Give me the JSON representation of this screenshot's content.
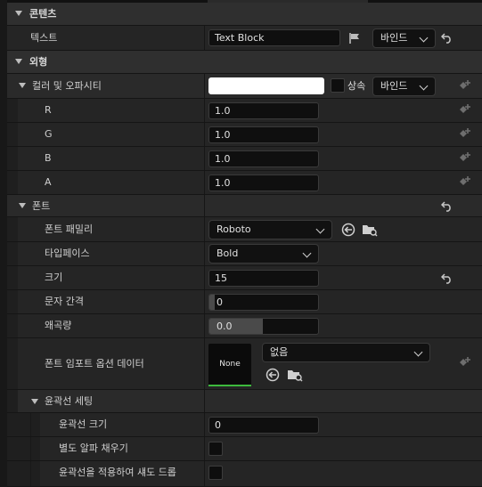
{
  "sections": {
    "content": {
      "title": "콘텐츠",
      "text_label": "텍스트",
      "text_value": "Text Block",
      "bind_label": "바인드"
    },
    "appearance": {
      "title": "외형",
      "color_label": "컬러 및 오파시티",
      "inherit_label": "상속",
      "bind_label": "바인드",
      "channels": [
        {
          "label": "R",
          "value": "1.0"
        },
        {
          "label": "G",
          "value": "1.0"
        },
        {
          "label": "B",
          "value": "1.0"
        },
        {
          "label": "A",
          "value": "1.0"
        }
      ],
      "color_swatch": "#FFFFFF"
    },
    "font": {
      "title": "폰트",
      "family_label": "폰트 패밀리",
      "family_value": "Roboto",
      "typeface_label": "타입페이스",
      "typeface_value": "Bold",
      "size_label": "크기",
      "size_value": "15",
      "letter_spacing_label": "문자 간격",
      "letter_spacing_value": "0",
      "skew_label": "왜곡량",
      "skew_value": "0.0",
      "skew_fraction": 0.0,
      "import_label": "폰트 임포트 옵션 데이터",
      "import_thumb": "None",
      "import_value": "없음",
      "outline": {
        "title": "윤곽선 세팅",
        "size_label": "윤곽선 크기",
        "size_value": "0",
        "separate_alpha_label": "별도 알파 채우기",
        "apply_shadow_label": "윤곽선을 적용하여 섀도 드롭"
      }
    }
  },
  "colors": {
    "accent_green": "#3DBA3D",
    "field_bg": "#0F0F0F",
    "category_bg": "#2F2F2F"
  }
}
